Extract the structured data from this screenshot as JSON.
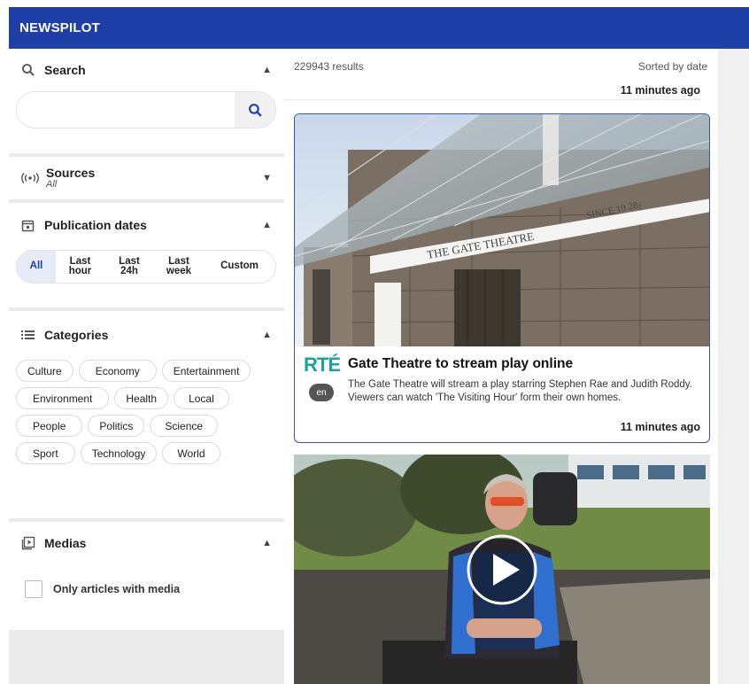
{
  "app": {
    "title": "NEWSPILOT"
  },
  "sidebar": {
    "search": {
      "title": "Search",
      "placeholder": ""
    },
    "sources": {
      "title": "Sources",
      "value": "All"
    },
    "publication_dates": {
      "title": "Publication dates",
      "options": [
        "All",
        "Last\nhour",
        "Last\n24h",
        "Last\nweek",
        "Custom"
      ],
      "selected": "All"
    },
    "categories": {
      "title": "Categories",
      "items": [
        "Culture",
        "Economy",
        "Entertainment",
        "Environment",
        "Health",
        "Local",
        "People",
        "Politics",
        "Science",
        "Sport",
        "Technology",
        "World"
      ]
    },
    "medias": {
      "title": "Medias",
      "checkbox_label": "Only articles with media",
      "checked": false
    }
  },
  "main": {
    "results_count": "229943 results",
    "sort_label": "Sorted by date",
    "previous_time": "11 minutes ago",
    "articles": [
      {
        "source_logo": "RTÉ",
        "title": "Gate Theatre to stream play online",
        "language": "en",
        "description": "The Gate Theatre will stream a play starring Stephen Rae and Judith Roddy. Viewers can watch 'The Visiting Hour' form their own homes.",
        "time": "11 minutes ago",
        "image_sign": "THE GATE THEATRE",
        "image_since": "SINCE 19 28"
      }
    ]
  },
  "colors": {
    "brand": "#1e3fa8",
    "rte": "#19a39a",
    "card_border": "#3a55a8"
  },
  "icons": {
    "search": "search-icon",
    "sources": "antenna-icon",
    "dates": "calendar-icon",
    "categories": "list-icon",
    "medias": "media-icon",
    "play": "play-icon"
  }
}
